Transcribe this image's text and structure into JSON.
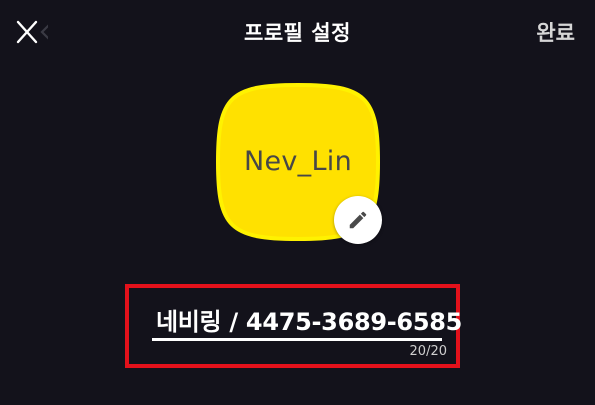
{
  "header": {
    "title": "프로필 설정",
    "done_label": "완료",
    "close_icon": "close-icon"
  },
  "profile": {
    "avatar_text": "Nev_Lin",
    "avatar_color": "#ffe100",
    "avatar_border_color": "#fff200",
    "edit_icon": "pencil-icon"
  },
  "name_field": {
    "value": "네비링 / 4475-3689-6585",
    "char_count": "20/20"
  },
  "colors": {
    "background": "#13121b",
    "highlight": "#e3111b"
  }
}
